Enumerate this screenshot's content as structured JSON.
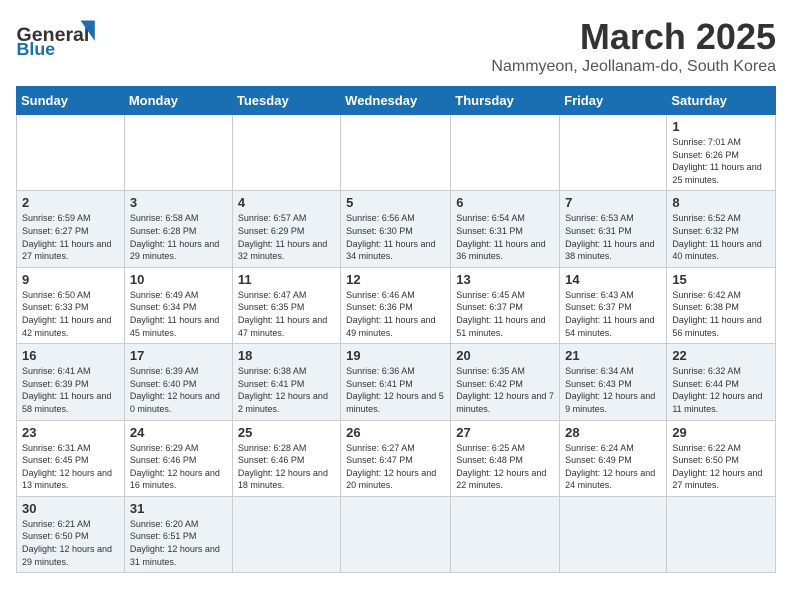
{
  "header": {
    "logo_general": "General",
    "logo_blue": "Blue",
    "month_title": "March 2025",
    "location": "Nammyeon, Jeollanam-do, South Korea"
  },
  "days_of_week": [
    "Sunday",
    "Monday",
    "Tuesday",
    "Wednesday",
    "Thursday",
    "Friday",
    "Saturday"
  ],
  "weeks": [
    {
      "days": [
        {
          "num": "",
          "info": ""
        },
        {
          "num": "",
          "info": ""
        },
        {
          "num": "",
          "info": ""
        },
        {
          "num": "",
          "info": ""
        },
        {
          "num": "",
          "info": ""
        },
        {
          "num": "",
          "info": ""
        },
        {
          "num": "1",
          "info": "Sunrise: 7:01 AM\nSunset: 6:26 PM\nDaylight: 11 hours and 25 minutes."
        }
      ]
    },
    {
      "days": [
        {
          "num": "2",
          "info": "Sunrise: 6:59 AM\nSunset: 6:27 PM\nDaylight: 11 hours and 27 minutes."
        },
        {
          "num": "3",
          "info": "Sunrise: 6:58 AM\nSunset: 6:28 PM\nDaylight: 11 hours and 29 minutes."
        },
        {
          "num": "4",
          "info": "Sunrise: 6:57 AM\nSunset: 6:29 PM\nDaylight: 11 hours and 32 minutes."
        },
        {
          "num": "5",
          "info": "Sunrise: 6:56 AM\nSunset: 6:30 PM\nDaylight: 11 hours and 34 minutes."
        },
        {
          "num": "6",
          "info": "Sunrise: 6:54 AM\nSunset: 6:31 PM\nDaylight: 11 hours and 36 minutes."
        },
        {
          "num": "7",
          "info": "Sunrise: 6:53 AM\nSunset: 6:31 PM\nDaylight: 11 hours and 38 minutes."
        },
        {
          "num": "8",
          "info": "Sunrise: 6:52 AM\nSunset: 6:32 PM\nDaylight: 11 hours and 40 minutes."
        }
      ]
    },
    {
      "days": [
        {
          "num": "9",
          "info": "Sunrise: 6:50 AM\nSunset: 6:33 PM\nDaylight: 11 hours and 42 minutes."
        },
        {
          "num": "10",
          "info": "Sunrise: 6:49 AM\nSunset: 6:34 PM\nDaylight: 11 hours and 45 minutes."
        },
        {
          "num": "11",
          "info": "Sunrise: 6:47 AM\nSunset: 6:35 PM\nDaylight: 11 hours and 47 minutes."
        },
        {
          "num": "12",
          "info": "Sunrise: 6:46 AM\nSunset: 6:36 PM\nDaylight: 11 hours and 49 minutes."
        },
        {
          "num": "13",
          "info": "Sunrise: 6:45 AM\nSunset: 6:37 PM\nDaylight: 11 hours and 51 minutes."
        },
        {
          "num": "14",
          "info": "Sunrise: 6:43 AM\nSunset: 6:37 PM\nDaylight: 11 hours and 54 minutes."
        },
        {
          "num": "15",
          "info": "Sunrise: 6:42 AM\nSunset: 6:38 PM\nDaylight: 11 hours and 56 minutes."
        }
      ]
    },
    {
      "days": [
        {
          "num": "16",
          "info": "Sunrise: 6:41 AM\nSunset: 6:39 PM\nDaylight: 11 hours and 58 minutes."
        },
        {
          "num": "17",
          "info": "Sunrise: 6:39 AM\nSunset: 6:40 PM\nDaylight: 12 hours and 0 minutes."
        },
        {
          "num": "18",
          "info": "Sunrise: 6:38 AM\nSunset: 6:41 PM\nDaylight: 12 hours and 2 minutes."
        },
        {
          "num": "19",
          "info": "Sunrise: 6:36 AM\nSunset: 6:41 PM\nDaylight: 12 hours and 5 minutes."
        },
        {
          "num": "20",
          "info": "Sunrise: 6:35 AM\nSunset: 6:42 PM\nDaylight: 12 hours and 7 minutes."
        },
        {
          "num": "21",
          "info": "Sunrise: 6:34 AM\nSunset: 6:43 PM\nDaylight: 12 hours and 9 minutes."
        },
        {
          "num": "22",
          "info": "Sunrise: 6:32 AM\nSunset: 6:44 PM\nDaylight: 12 hours and 11 minutes."
        }
      ]
    },
    {
      "days": [
        {
          "num": "23",
          "info": "Sunrise: 6:31 AM\nSunset: 6:45 PM\nDaylight: 12 hours and 13 minutes."
        },
        {
          "num": "24",
          "info": "Sunrise: 6:29 AM\nSunset: 6:46 PM\nDaylight: 12 hours and 16 minutes."
        },
        {
          "num": "25",
          "info": "Sunrise: 6:28 AM\nSunset: 6:46 PM\nDaylight: 12 hours and 18 minutes."
        },
        {
          "num": "26",
          "info": "Sunrise: 6:27 AM\nSunset: 6:47 PM\nDaylight: 12 hours and 20 minutes."
        },
        {
          "num": "27",
          "info": "Sunrise: 6:25 AM\nSunset: 6:48 PM\nDaylight: 12 hours and 22 minutes."
        },
        {
          "num": "28",
          "info": "Sunrise: 6:24 AM\nSunset: 6:49 PM\nDaylight: 12 hours and 24 minutes."
        },
        {
          "num": "29",
          "info": "Sunrise: 6:22 AM\nSunset: 6:50 PM\nDaylight: 12 hours and 27 minutes."
        }
      ]
    },
    {
      "days": [
        {
          "num": "30",
          "info": "Sunrise: 6:21 AM\nSunset: 6:50 PM\nDaylight: 12 hours and 29 minutes."
        },
        {
          "num": "31",
          "info": "Sunrise: 6:20 AM\nSunset: 6:51 PM\nDaylight: 12 hours and 31 minutes."
        },
        {
          "num": "",
          "info": ""
        },
        {
          "num": "",
          "info": ""
        },
        {
          "num": "",
          "info": ""
        },
        {
          "num": "",
          "info": ""
        },
        {
          "num": "",
          "info": ""
        }
      ]
    }
  ]
}
